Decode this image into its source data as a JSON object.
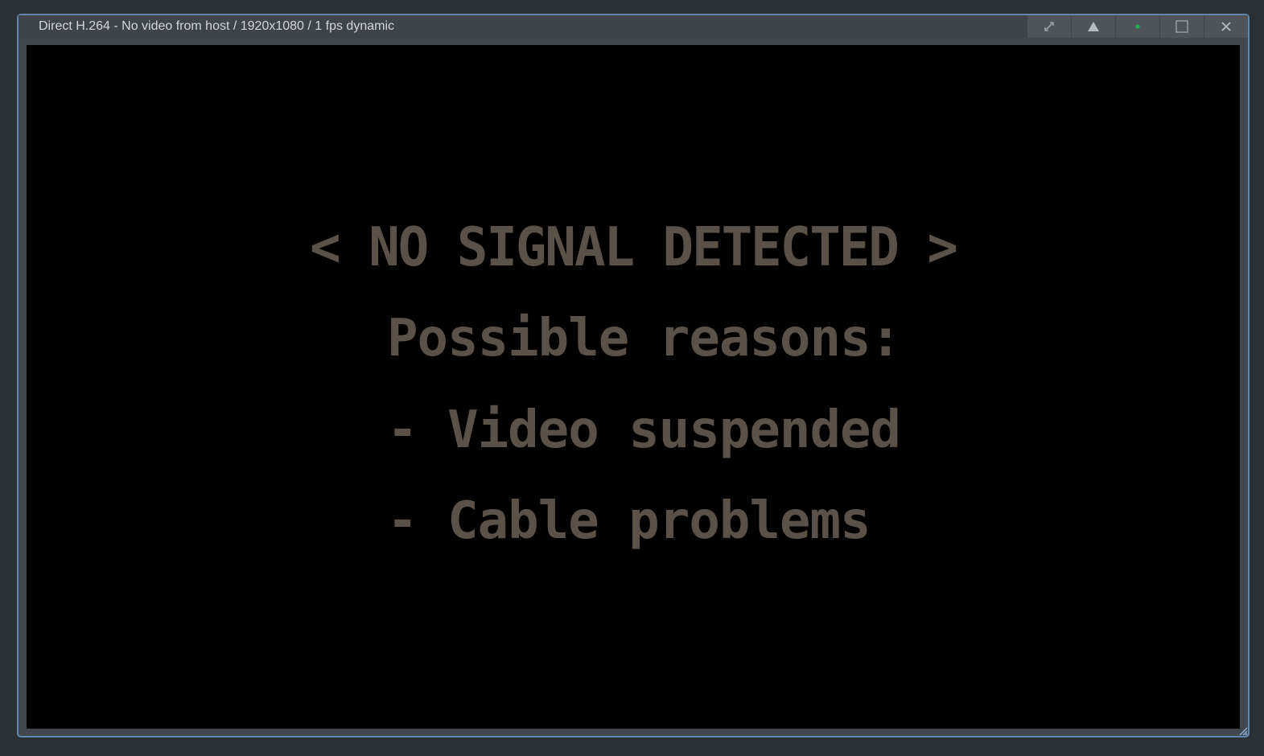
{
  "window": {
    "title": "Direct H.264 - No video from host / 1920x1080 / 1 fps dynamic",
    "controls": [
      {
        "name": "fullscreen",
        "icon": "expand-arrows-icon"
      },
      {
        "name": "eject",
        "icon": "triangle-up-icon"
      },
      {
        "name": "status",
        "icon": "status-dot-icon",
        "color": "#1bb34a"
      },
      {
        "name": "maximize",
        "icon": "square-icon"
      },
      {
        "name": "close",
        "icon": "close-icon"
      }
    ]
  },
  "screen": {
    "headline": "< NO SIGNAL DETECTED >",
    "reasons_label": "Possible reasons:",
    "reasons": [
      "- Video suspended",
      "- Cable problems"
    ],
    "text_color": "#5a5248"
  }
}
